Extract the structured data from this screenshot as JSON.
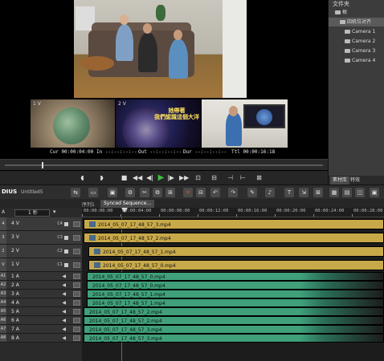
{
  "preview": {
    "thumb_labels": [
      "1 V",
      "2 V",
      "3 V"
    ],
    "overlay_text": "她帶著\n我們認識這個大洋",
    "timecodes": {
      "cur": "Cur 00:00:04:00",
      "in": "In --:--:--:--",
      "out": "Out --:--:--:--",
      "dur": "Dur --:--:--:--",
      "ttl": "Ttl 00:00:16:18"
    }
  },
  "transport": {
    "buttons": [
      "◖",
      "◗",
      "■",
      "◀◀",
      "◀|",
      "▶",
      "|▶",
      "▶▶",
      "⊡",
      "⊟",
      "⊣",
      "⊢",
      "⊠"
    ]
  },
  "folder_panel": {
    "header": "文件夹",
    "items": [
      {
        "label": "根",
        "level": 0
      },
      {
        "label": "四机位对齐",
        "level": 1,
        "selected": true
      },
      {
        "label": "Camera 1",
        "level": 2
      },
      {
        "label": "Camera 2",
        "level": 2
      },
      {
        "label": "Camera 3",
        "level": 2
      },
      {
        "label": "Camera 4",
        "level": 2
      }
    ],
    "tabs": [
      "素材库",
      "特效"
    ]
  },
  "app": {
    "brand": "DIUS",
    "project": "Untitled5"
  },
  "sequence": {
    "label": "序列1",
    "tab": "Synced Sequence..."
  },
  "ruler": {
    "ticks": [
      "00:00:00:00",
      "00:00:04:00",
      "00:00:08:00",
      "00:00:12:00",
      "00:00:16:00",
      "00:00:20:00",
      "00:00:24:00",
      "00:00:28:00"
    ]
  },
  "scale": {
    "label": "1 秒"
  },
  "tracks": [
    {
      "num": "4",
      "name": "4 V",
      "badge": "C4",
      "type": "video",
      "clip": "2014_05_07_17_48_57_3.mp4"
    },
    {
      "num": "3",
      "name": "3 V",
      "badge": "C3",
      "type": "video",
      "clip": "2014_05_07_17_48_57_2.mp4"
    },
    {
      "num": "2",
      "name": "2 V",
      "badge": "C2",
      "type": "video",
      "clip": "2014_05_07_17_48_57_1.mp4"
    },
    {
      "num": "V",
      "name": "1 V",
      "badge": "C1",
      "type": "video",
      "clip": "2014_05_07_17_48_57_0.mp4"
    },
    {
      "num": "A1",
      "name": "1 A",
      "badge": "",
      "type": "audio",
      "clip": "2014_05_07_17_48_57_0.mp4"
    },
    {
      "num": "A2",
      "name": "2 A",
      "badge": "",
      "type": "audio",
      "clip": "2014_05_07_17_48_57_0.mp4"
    },
    {
      "num": "A3",
      "name": "3 A",
      "badge": "",
      "type": "audio",
      "clip": "2014_05_07_17_48_57_1.mp4"
    },
    {
      "num": "A4",
      "name": "4 A",
      "badge": "",
      "type": "audio",
      "clip": "2014_05_07_17_48_57_1.mp4"
    },
    {
      "num": "A5",
      "name": "5 A",
      "badge": "",
      "type": "audio",
      "clip": "2014_05_07_17_48_57_2.mp4"
    },
    {
      "num": "A6",
      "name": "6 A",
      "badge": "",
      "type": "audio",
      "clip": "2014_05_07_17_48_57_2.mp4"
    },
    {
      "num": "A7",
      "name": "7 A",
      "badge": "",
      "type": "audio",
      "clip": "2014_05_07_17_48_57_3.mp4"
    },
    {
      "num": "A8",
      "name": "8 A",
      "badge": "",
      "type": "audio",
      "clip": "2014_05_07_17_48_57_3.mp4"
    }
  ],
  "colors": {
    "video_clip": "#c8a94a",
    "audio_clip": "#3fa07a",
    "play_button": "#3fbf3f"
  }
}
